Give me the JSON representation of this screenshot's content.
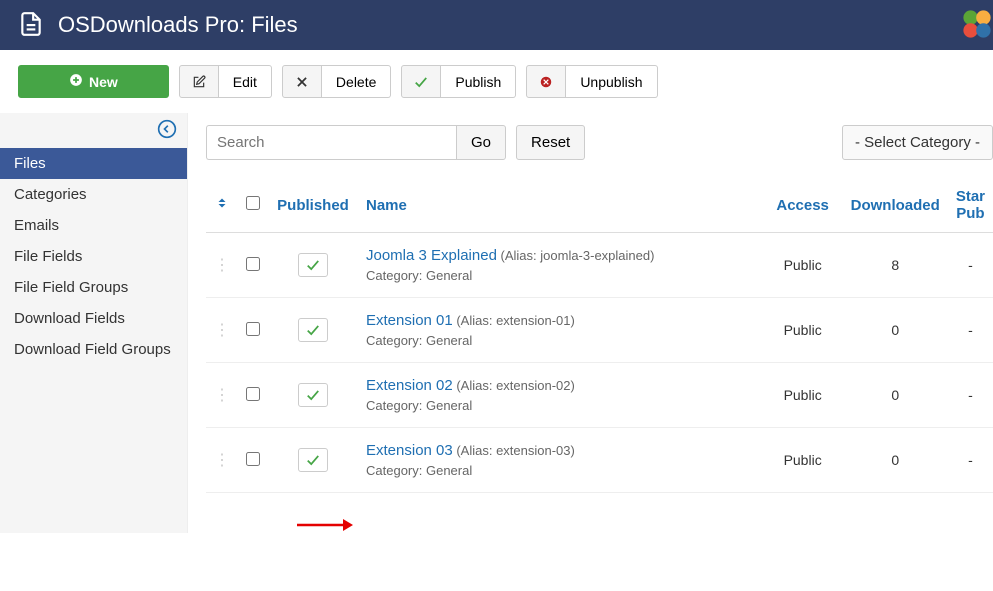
{
  "header": {
    "title": "OSDownloads Pro: Files"
  },
  "toolbar": {
    "new_label": "New",
    "edit_label": "Edit",
    "delete_label": "Delete",
    "publish_label": "Publish",
    "unpublish_label": "Unpublish"
  },
  "sidebar": {
    "items": [
      {
        "label": "Files",
        "active": true
      },
      {
        "label": "Categories",
        "active": false
      },
      {
        "label": "Emails",
        "active": false
      },
      {
        "label": "File Fields",
        "active": false
      },
      {
        "label": "File Field Groups",
        "active": false
      },
      {
        "label": "Download Fields",
        "active": false
      },
      {
        "label": "Download Field Groups",
        "active": false
      }
    ]
  },
  "search": {
    "placeholder": "Search",
    "go_label": "Go",
    "reset_label": "Reset",
    "category_select": "- Select Category -"
  },
  "table": {
    "headers": {
      "published": "Published",
      "name": "Name",
      "access": "Access",
      "downloaded": "Downloaded",
      "start_publishing": "Start Publishing"
    },
    "rows": [
      {
        "name": "Joomla 3 Explained",
        "alias": "(Alias: joomla-3-explained)",
        "category": "Category: General",
        "access": "Public",
        "downloaded": "8",
        "start": "-"
      },
      {
        "name": "Extension 01",
        "alias": "(Alias: extension-01)",
        "category": "Category: General",
        "access": "Public",
        "downloaded": "0",
        "start": "-"
      },
      {
        "name": "Extension 02",
        "alias": "(Alias: extension-02)",
        "category": "Category: General",
        "access": "Public",
        "downloaded": "0",
        "start": "-"
      },
      {
        "name": "Extension 03",
        "alias": "(Alias: extension-03)",
        "category": "Category: General",
        "access": "Public",
        "downloaded": "0",
        "start": "-"
      }
    ]
  }
}
